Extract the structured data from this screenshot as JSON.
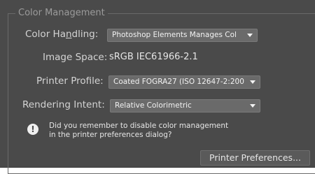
{
  "group": {
    "title": "Color Management"
  },
  "rows": {
    "color_handling": {
      "label_pre": "Color Ha",
      "label_mnemonic": "n",
      "label_post": "dling:",
      "value": "Photoshop Elements Manages Col"
    },
    "image_space": {
      "label": "Image Space:",
      "value": "sRGB IEC61966-2.1"
    },
    "printer_profile": {
      "label": "Printer Profile:",
      "value": "Coated FOGRA27 (ISO 12647-2:200"
    },
    "rendering_intent": {
      "label": "Rendering Intent:",
      "value": "Relative Colorimetric"
    }
  },
  "notice": {
    "icon": "info-exclamation-icon",
    "line1": "Did you remember to disable color management",
    "line2": "in the printer preferences dialog?"
  },
  "buttons": {
    "printer_preferences": "Printer Preferences..."
  },
  "colors": {
    "panel_bg": "#4a4a4a",
    "control_bg": "#6a6a6a",
    "text": "#d4d4d4"
  }
}
